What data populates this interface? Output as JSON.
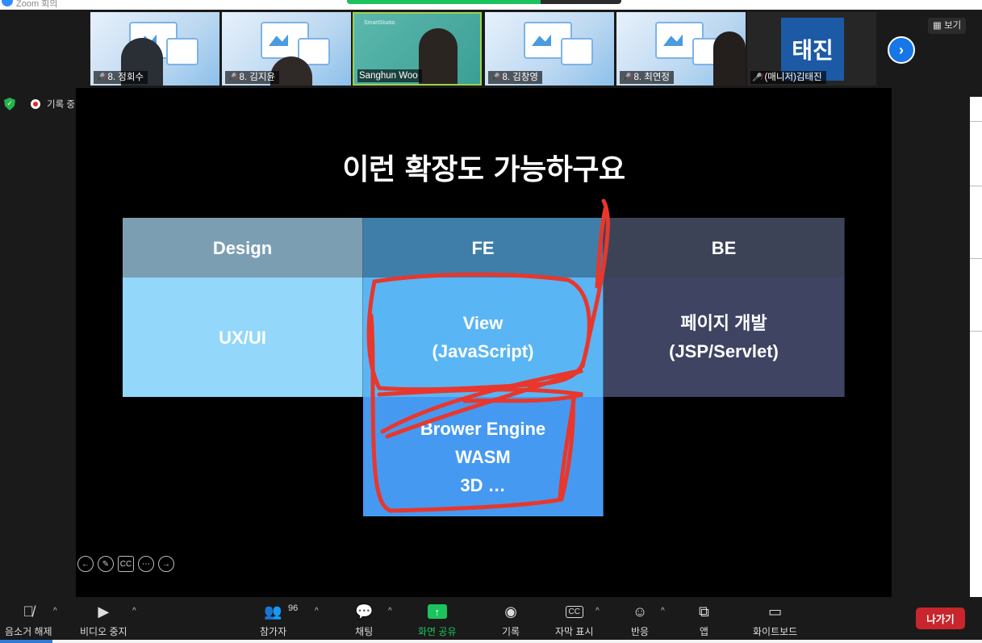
{
  "window": {
    "title": "Zoom 회의"
  },
  "participants": [
    {
      "name": "8. 정회수",
      "muted": true
    },
    {
      "name": "8. 김지윤",
      "muted": true
    },
    {
      "name": "Sanghun Woo",
      "muted": false,
      "studio": "SmartStudio"
    },
    {
      "name": "8. 김창영",
      "muted": true
    },
    {
      "name": "8. 최연정",
      "muted": true
    },
    {
      "name": "(매니저)김태진",
      "muted": true,
      "avatar": "태진"
    }
  ],
  "view_button": "보기",
  "status": {
    "recording": "기록 중"
  },
  "slide": {
    "title": "이런 확장도 가능하구요",
    "headers": [
      "Design",
      "FE",
      "BE"
    ],
    "design_cell": "UX/UI",
    "fe_view": [
      "View",
      "(JavaScript)"
    ],
    "be_cell": [
      "페이지 개발",
      "(JSP/Servlet)"
    ],
    "fe_engine": [
      "Brower Engine",
      "WASM",
      "3D …"
    ]
  },
  "toolbar": {
    "unmute": "음소거 해제",
    "stop_video": "비디오 중지",
    "participants": "참가자",
    "participant_count": "96",
    "chat": "채팅",
    "share_screen": "화면 공유",
    "record": "기록",
    "captions": "자막 표시",
    "cc_icon_text": "CC",
    "reactions": "반응",
    "apps": "앱",
    "whiteboard": "화이트보드",
    "leave": "나가기"
  },
  "colors": {
    "accent_green": "#1bc35d",
    "leave_red": "#c8252c",
    "annotation_red": "#e8372c"
  }
}
